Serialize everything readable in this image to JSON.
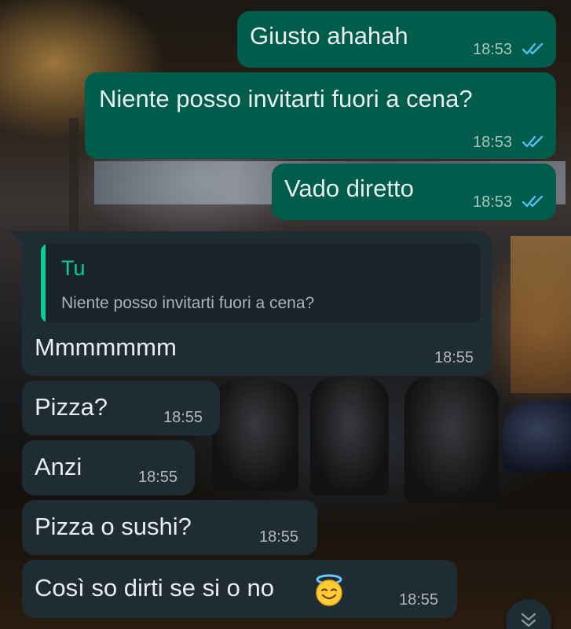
{
  "conversation": {
    "messages": [
      {
        "text": "Giusto ahahah",
        "time": "18:53",
        "direction": "outgoing",
        "status": "read"
      },
      {
        "text": "Niente posso invitarti fuori a cena?",
        "time": "18:53",
        "direction": "outgoing",
        "status": "read"
      },
      {
        "text": "Vado diretto",
        "time": "18:53",
        "direction": "outgoing",
        "status": "read"
      },
      {
        "text": "Mmmmmmm",
        "time": "18:55",
        "direction": "incoming",
        "reply_to": {
          "author": "Tu",
          "text": "Niente posso invitarti fuori a cena?"
        }
      },
      {
        "text": "Pizza?",
        "time": "18:55",
        "direction": "incoming"
      },
      {
        "text": "Anzi",
        "time": "18:55",
        "direction": "incoming"
      },
      {
        "text": "Pizza o sushi?",
        "time": "18:55",
        "direction": "incoming"
      },
      {
        "text": "Così so dirti se si o no",
        "time": "18:55",
        "direction": "incoming",
        "emoji": "smiling-face-with-halo"
      }
    ]
  },
  "icons": {
    "read_receipt": "double-check-icon",
    "scroll_down": "double-chevron-down-icon"
  },
  "colors": {
    "outgoing_bubble": "#005c4b",
    "incoming_bubble": "#1f2c34",
    "read_tick": "#53bdeb",
    "quote_accent": "#06cf9c"
  }
}
